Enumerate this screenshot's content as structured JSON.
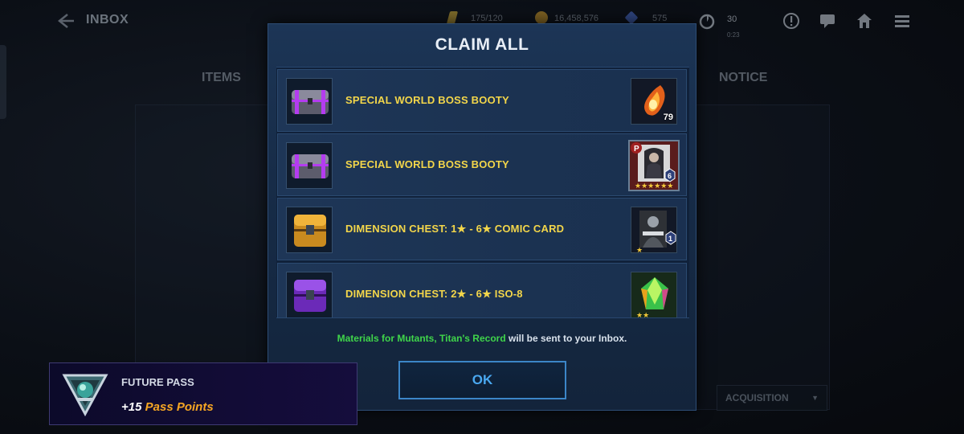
{
  "header": {
    "back_icon": "back-arrow-icon",
    "title": "INBOX",
    "stamina": "175/120",
    "gold": "16,458,576",
    "crystals": "575",
    "timer_count": "30",
    "timer_sub": "0:23"
  },
  "tabs": {
    "items": "ITEMS",
    "notice": "NOTICE"
  },
  "filter": {
    "selected": "ACQUISITION"
  },
  "modal": {
    "title": "CLAIM ALL",
    "rows": [
      {
        "label": "SPECIAL WORLD BOSS BOOTY",
        "icon": "purple-chest-icon",
        "reward_icon": "fire-orb-icon",
        "reward_count": "79"
      },
      {
        "label": "SPECIAL WORLD BOSS BOOTY",
        "icon": "purple-chest-icon",
        "reward_icon": "comic-card-icon",
        "reward_badge": "6",
        "reward_tag": "P"
      },
      {
        "label": "DIMENSION CHEST: 1★ - 6★ COMIC CARD",
        "icon": "gold-cube-chest-icon",
        "reward_icon": "xforce-comic-card-icon",
        "reward_badge": "1"
      },
      {
        "label": "DIMENSION CHEST: 2★ - 6★ ISO-8",
        "icon": "purple-cube-chest-icon",
        "reward_icon": "iso8-crystal-icon"
      }
    ],
    "notice_highlight": "Materials for Mutants, Titan's Record",
    "notice_rest": " will be sent to your Inbox.",
    "ok_label": "OK"
  },
  "toast": {
    "title": "FUTURE PASS",
    "points_prefix": "+15 ",
    "points_label": "Pass Points",
    "emblem_icon": "future-pass-emblem-icon"
  },
  "colors": {
    "accent_blue": "#4aa8f0",
    "row_label_yellow": "#f3d64a",
    "notice_green": "#3fd54a",
    "pass_orange": "#f6a623"
  }
}
